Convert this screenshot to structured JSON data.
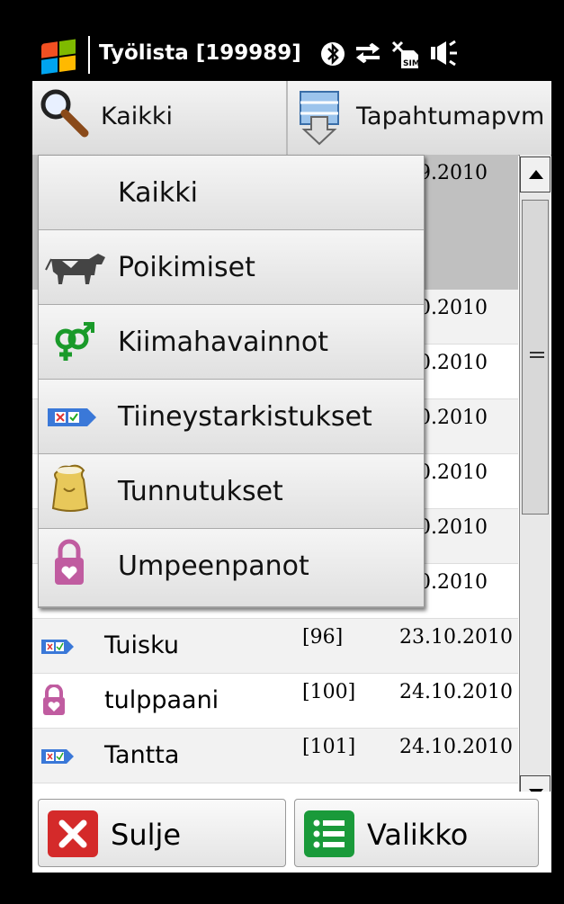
{
  "statusbar": {
    "title": "Työlista [199989]",
    "icons": [
      "bluetooth-icon",
      "data-sync-icon",
      "no-sim-icon",
      "speaker-icon"
    ]
  },
  "toolbar": {
    "filter_label": "Kaikki",
    "filter_icon": "magnifier-icon",
    "sort_label": "Tapahtumapvm",
    "sort_icon": "sort-icon"
  },
  "dropdown": {
    "items": [
      {
        "label": "Kaikki",
        "icon": ""
      },
      {
        "label": "Poikimiset",
        "icon": "cow-icon"
      },
      {
        "label": "Kiimahavainnot",
        "icon": "gender-symbol-icon"
      },
      {
        "label": "Tiineystarkistukset",
        "icon": "pregnancy-check-tag-icon"
      },
      {
        "label": "Tunnutukset",
        "icon": "feed-sack-icon"
      },
      {
        "label": "Umpeenpanot",
        "icon": "padlock-heart-icon"
      }
    ]
  },
  "list": {
    "rows": [
      {
        "name": "",
        "number": "",
        "date": ".09.2010",
        "icon": "",
        "selected": true
      },
      {
        "name": "",
        "number": "",
        "date": ".10.2010",
        "icon": ""
      },
      {
        "name": "",
        "number": "",
        "date": ".10.2010",
        "icon": ""
      },
      {
        "name": "",
        "number": "",
        "date": ".10.2010",
        "icon": ""
      },
      {
        "name": "",
        "number": "",
        "date": ".10.2010",
        "icon": ""
      },
      {
        "name": "",
        "number": "",
        "date": ".10.2010",
        "icon": ""
      },
      {
        "name": "",
        "number": "",
        "date": ".10.2010",
        "icon": ""
      },
      {
        "name": "Tuisku",
        "number": "[96]",
        "date": "23.10.2010",
        "icon": "pregnancy-check-tag-icon"
      },
      {
        "name": "tulppaani",
        "number": "[100]",
        "date": "24.10.2010",
        "icon": "padlock-heart-icon"
      },
      {
        "name": "Tantta",
        "number": "[101]",
        "date": "24.10.2010",
        "icon": "pregnancy-check-tag-icon"
      }
    ]
  },
  "bottombar": {
    "close_label": "Sulje",
    "menu_label": "Valikko"
  },
  "colors": {
    "close_red": "#d42a2a",
    "menu_green": "#1a9a3a",
    "selected_row": "#c0c0c0",
    "tag_blue": "#3a78d8",
    "padlock_pink": "#c05ca0",
    "gender_green": "#1a9a2a"
  }
}
